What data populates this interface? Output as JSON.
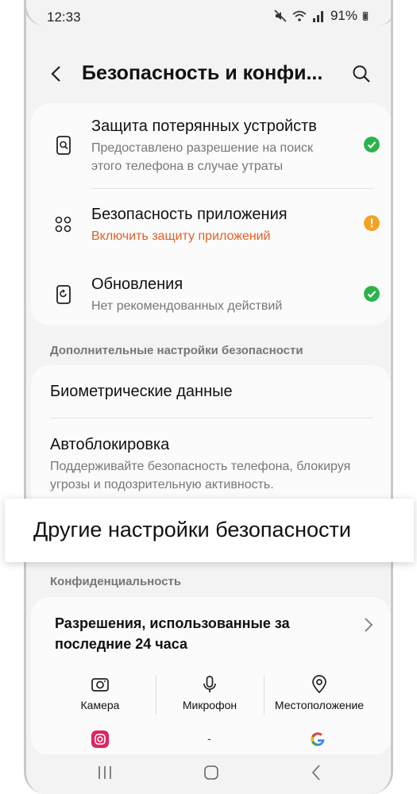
{
  "status": {
    "time": "12:33",
    "battery": "91%"
  },
  "header": {
    "title": "Безопасность и конфи..."
  },
  "security_items": [
    {
      "title": "Защита потерянных устройств",
      "subtitle": "Предоставлено разрешение на поиск этого телефона в случае утраты",
      "status": "ok",
      "icon": "lost-device-icon"
    },
    {
      "title": "Безопасность приложения",
      "subtitle": "Включить защиту приложений",
      "status": "warning",
      "icon": "app-security-icon"
    },
    {
      "title": "Обновления",
      "subtitle": "Нет рекомендованных действий",
      "status": "ok",
      "icon": "updates-icon"
    }
  ],
  "additional_section": {
    "label": "Дополнительные настройки безопасности",
    "biometrics": "Биометрические данные",
    "autoblock_title": "Автоблокировка",
    "autoblock_sub": "Поддерживайте безопасность телефона, блокируя угрозы и подозрительную активность.",
    "other_settings": "Другие настройки безопасности"
  },
  "privacy_section": {
    "label": "Конфиденциальность",
    "permissions_title": "Разрешения, использованные за последние 24 часа",
    "columns": [
      "Камера",
      "Микрофон",
      "Местоположение"
    ],
    "mic_apps": "-"
  },
  "colors": {
    "ok": "#2bb34a",
    "warning": "#f4a223",
    "warning_text": "#e0602a"
  }
}
